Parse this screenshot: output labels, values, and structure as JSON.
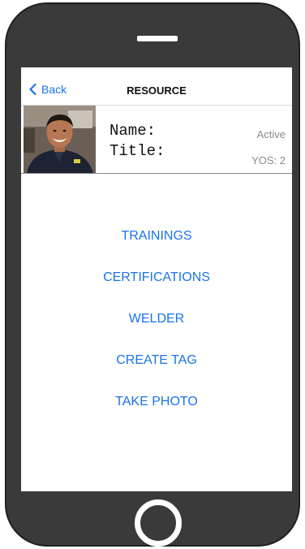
{
  "nav": {
    "back_label": "Back",
    "title": "RESOURCE"
  },
  "profile": {
    "name_label": "Name:",
    "title_label": "Title:",
    "status": "Active",
    "yos": "YOS: 2",
    "avatar_icon": "person-photo"
  },
  "menu": {
    "items": [
      {
        "label": "TRAININGS"
      },
      {
        "label": "CERTIFICATIONS"
      },
      {
        "label": "WELDER"
      },
      {
        "label": "CREATE TAG"
      },
      {
        "label": "TAKE PHOTO"
      }
    ]
  },
  "colors": {
    "accent": "#1a73e8",
    "phone_body": "#3a3a3a",
    "muted_text": "#8a8a8a"
  },
  "icons": {
    "back": "chevron-left-icon",
    "home": "home-button-ring",
    "speaker": "speaker-slot"
  }
}
